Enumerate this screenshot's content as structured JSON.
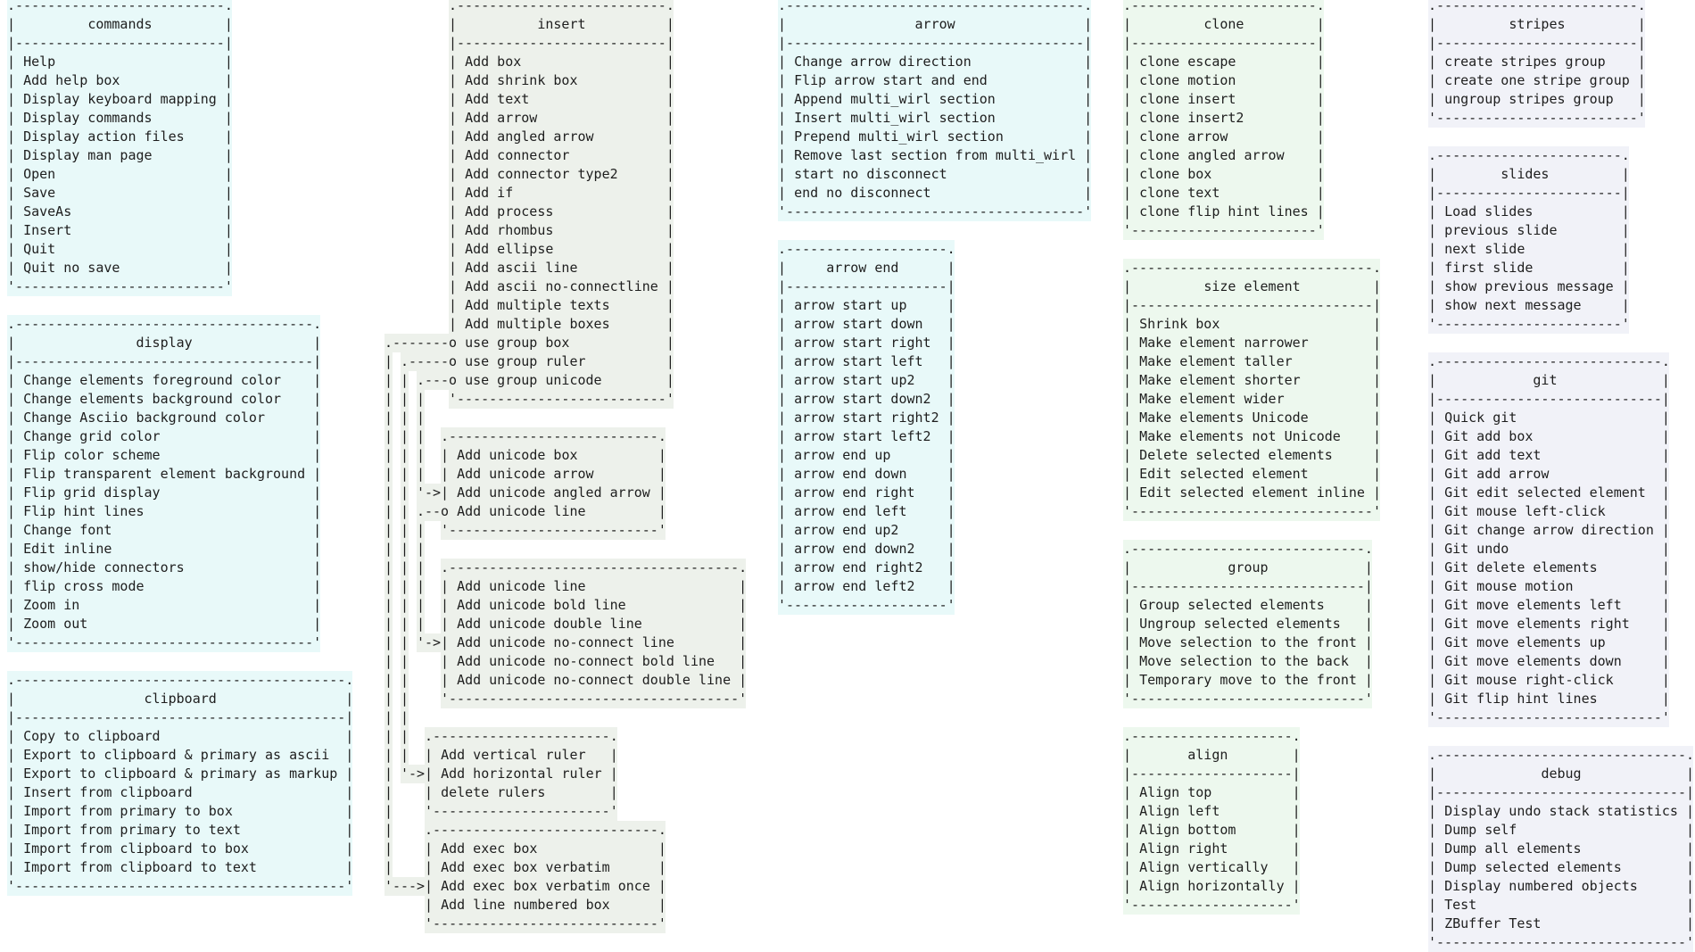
{
  "colors": {
    "cyan": "#e8f9f9",
    "insert": "#edf1eb",
    "green": "#edf8ee",
    "lavender": "#f1f2f8",
    "text": "#1e1e1e"
  },
  "boxes": {
    "commands": {
      "title": "commands",
      "color": "#e8f9f9",
      "items": [
        "Help",
        "Add help box",
        "Display keyboard mapping",
        "Display commands",
        "Display action files",
        "Display man page",
        "Open",
        "Save",
        "SaveAs",
        "Insert",
        "Quit",
        "Quit no save"
      ]
    },
    "display": {
      "title": "display",
      "color": "#e8f9f9",
      "items": [
        "Change elements foreground color",
        "Change elements background color",
        "Change Asciio background color",
        "Change grid color",
        "Flip color scheme",
        "Flip transparent element background",
        "Flip grid display",
        "Flip hint lines",
        "Change font",
        "Edit inline",
        "show/hide connectors",
        "flip cross mode",
        "Zoom in",
        "Zoom out"
      ]
    },
    "clipboard": {
      "title": "clipboard",
      "color": "#e8f9f9",
      "items": [
        "Copy to clipboard",
        "Export to clipboard & primary as ascii",
        "Export to clipboard & primary as markup",
        "Insert from clipboard",
        "Import from primary to box",
        "Import from primary to text",
        "Import from clipboard to box",
        "Import from clipboard to text"
      ]
    },
    "insert": {
      "title": "insert",
      "color": "#edf1eb",
      "items": [
        "Add box",
        "Add shrink box",
        "Add text",
        "Add arrow",
        "Add angled arrow",
        "Add connector",
        "Add connector type2",
        "Add if",
        "Add process",
        "Add rhombus",
        "Add ellipse",
        "Add ascii line",
        "Add ascii no-connectline",
        "Add multiple texts",
        "Add multiple boxes",
        "use group box",
        "use group ruler",
        "use group unicode"
      ]
    },
    "unicode_box": {
      "color": "#edf1eb",
      "items": [
        "Add unicode box",
        "Add unicode arrow",
        "Add unicode angled arrow",
        "Add unicode line"
      ]
    },
    "unicode_line": {
      "color": "#edf1eb",
      "items": [
        "Add unicode line",
        "Add unicode bold line",
        "Add unicode double line",
        "Add unicode no-connect line",
        "Add unicode no-connect bold line",
        "Add unicode no-connect double line"
      ]
    },
    "rulers": {
      "color": "#edf1eb",
      "items": [
        "Add vertical ruler",
        "Add horizontal ruler",
        "delete rulers"
      ]
    },
    "exec": {
      "color": "#edf1eb",
      "items": [
        "Add exec box",
        "Add exec box verbatim",
        "Add exec box verbatim once",
        "Add line numbered box"
      ]
    },
    "arrow": {
      "title": "arrow",
      "color": "#e8f9f9",
      "items": [
        "Change arrow direction",
        "Flip arrow start and end",
        "Append multi_wirl section",
        "Insert multi_wirl section",
        "Prepend multi_wirl section",
        "Remove last section from multi_wirl",
        "start no disconnect",
        "end no disconnect"
      ]
    },
    "arrow_end": {
      "title": "arrow end",
      "color": "#e8f9f9",
      "items": [
        "arrow start up",
        "arrow start down",
        "arrow start right",
        "arrow start left",
        "arrow start up2",
        "arrow start down2",
        "arrow start right2",
        "arrow start left2",
        "arrow end up",
        "arrow end down",
        "arrow end right",
        "arrow end left",
        "arrow end up2",
        "arrow end down2",
        "arrow end right2",
        "arrow end left2"
      ]
    },
    "clone": {
      "title": "clone",
      "color": "#edf8ee",
      "items": [
        "clone escape",
        "clone motion",
        "clone insert",
        "clone insert2",
        "clone arrow",
        "clone angled arrow",
        "clone box",
        "clone text",
        "clone flip hint lines"
      ]
    },
    "size_element": {
      "title": "size element",
      "color": "#edf8ee",
      "items": [
        "Shrink box",
        "Make element narrower",
        "Make element taller",
        "Make element shorter",
        "Make element wider",
        "Make elements Unicode",
        "Make elements not Unicode",
        "Delete selected elements",
        "Edit selected element",
        "Edit selected element inline"
      ]
    },
    "group": {
      "title": "group",
      "color": "#edf8ee",
      "items": [
        "Group selected elements",
        "Ungroup selected elements",
        "Move selection to the front",
        "Move selection to the back",
        "Temporary move to the front"
      ]
    },
    "align": {
      "title": "align",
      "color": "#edf8ee",
      "items": [
        "Align top",
        "Align left",
        "Align bottom",
        "Align right",
        "Align vertically",
        "Align horizontally"
      ]
    },
    "stripes": {
      "title": "stripes",
      "color": "#f1f2f8",
      "items": [
        "create stripes group",
        "create one stripe group",
        "ungroup stripes group"
      ]
    },
    "slides": {
      "title": "slides",
      "color": "#f1f2f8",
      "items": [
        "Load slides",
        "previous slide",
        "next slide",
        "first slide",
        "show previous message",
        "show next message"
      ]
    },
    "git": {
      "title": "git",
      "color": "#f1f2f8",
      "items": [
        "Quick git",
        "Git add box",
        "Git add text",
        "Git add arrow",
        "Git edit selected element",
        "Git mouse left-click",
        "Git change arrow direction",
        "Git undo",
        "Git delete elements",
        "Git mouse motion",
        "Git move elements left",
        "Git move elements right",
        "Git move elements up",
        "Git move elements down",
        "Git mouse right-click",
        "Git flip hint lines"
      ]
    },
    "debug": {
      "title": "debug",
      "color": "#f1f2f8",
      "items": [
        "Display undo stack statistics",
        "Dump self",
        "Dump all elements",
        "Dump selected elements",
        "Display numbered objects",
        "Test",
        "ZBuffer Test"
      ]
    }
  }
}
